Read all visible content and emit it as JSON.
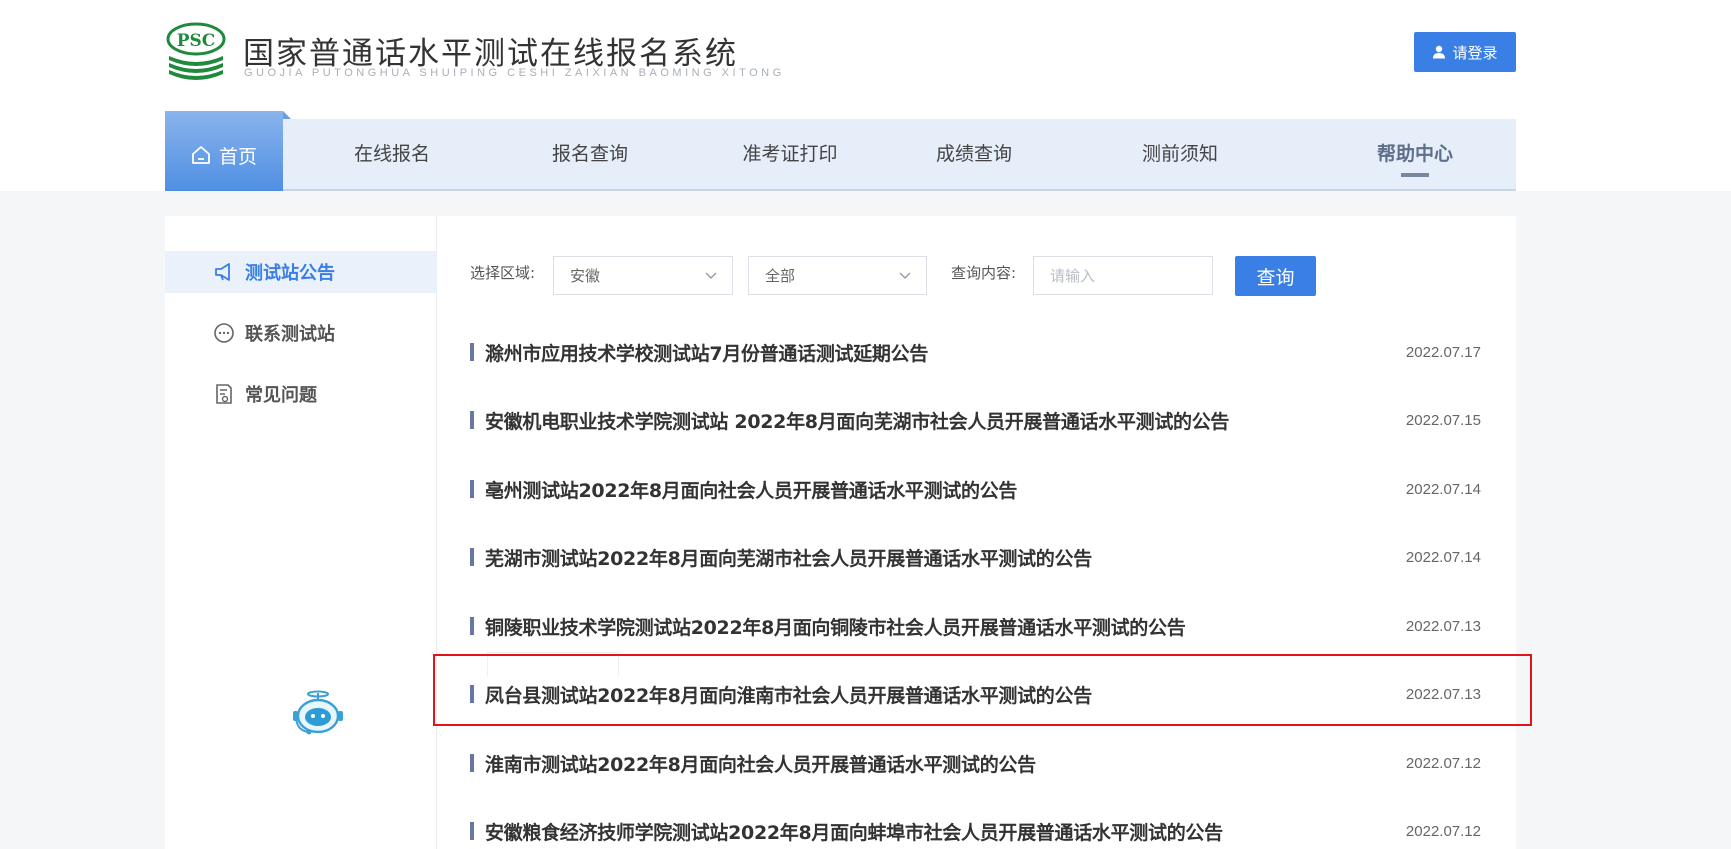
{
  "header": {
    "logo_badge": "PSC",
    "title": "国家普通话水平测试在线报名系统",
    "subtitle": "GUOJIA PUTONGHUA SHUIPING CESHI ZAIXIAN BAOMING XITONG",
    "login_label": "请登录"
  },
  "nav": {
    "home": "首页",
    "items": [
      "在线报名",
      "报名查询",
      "准考证打印",
      "成绩查询",
      "测前须知",
      "帮助中心"
    ],
    "active": "帮助中心"
  },
  "sidebar": {
    "items": [
      {
        "label": "测试站公告",
        "icon": "megaphone-icon",
        "active": true
      },
      {
        "label": "联系测试站",
        "icon": "chat-bubble-icon",
        "active": false
      },
      {
        "label": "常见问题",
        "icon": "document-question-icon",
        "active": false
      }
    ]
  },
  "filters": {
    "region_label": "选择区域:",
    "region_value": "安徽",
    "city_value": "全部",
    "query_label": "查询内容:",
    "query_placeholder": "请输入",
    "query_button": "查询"
  },
  "notices": [
    {
      "title": "滁州市应用技术学校测试站7月份普通话测试延期公告",
      "date": "2022.07.17"
    },
    {
      "title": "安徽机电职业技术学院测试站 2022年8月面向芜湖市社会人员开展普通话水平测试的公告",
      "date": "2022.07.15"
    },
    {
      "title": "亳州测试站2022年8月面向社会人员开展普通话水平测试的公告",
      "date": "2022.07.14"
    },
    {
      "title": "芜湖市测试站2022年8月面向芜湖市社会人员开展普通话水平测试的公告",
      "date": "2022.07.14"
    },
    {
      "title": "铜陵职业技术学院测试站2022年8月面向铜陵市社会人员开展普通话水平测试的公告",
      "date": "2022.07.13"
    },
    {
      "title": "凤台县测试站2022年8月面向淮南市社会人员开展普通话水平测试的公告",
      "date": "2022.07.13"
    },
    {
      "title": "淮南市测试站2022年8月面向社会人员开展普通话水平测试的公告",
      "date": "2022.07.12"
    },
    {
      "title": "安徽粮食经济技师学院测试站2022年8月面向蚌埠市社会人员开展普通话水平测试的公告",
      "date": "2022.07.12"
    }
  ],
  "colors": {
    "accent": "#3a7fe6",
    "highlight": "#e0151b"
  }
}
